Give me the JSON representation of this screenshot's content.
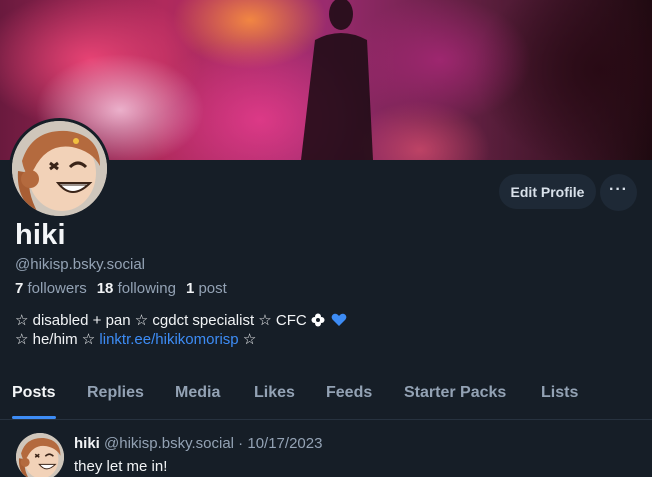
{
  "profile": {
    "display_name": "hiki",
    "handle": "@hikisp.bsky.social",
    "followers_count": "7",
    "followers_label": "followers",
    "following_count": "18",
    "following_label": "following",
    "posts_count": "1",
    "posts_label": "post",
    "bio_line1": "☆ disabled + pan ☆ cgdct specialist ☆ CFC",
    "bio_line2_prefix": "☆ he/him ☆ ",
    "bio_link": "linktr.ee/hikikomorisp",
    "bio_line2_suffix": " ☆"
  },
  "actions": {
    "edit_profile": "Edit Profile",
    "more": "···"
  },
  "tabs": [
    {
      "label": "Posts",
      "active": true
    },
    {
      "label": "Replies",
      "active": false
    },
    {
      "label": "Media",
      "active": false
    },
    {
      "label": "Likes",
      "active": false
    },
    {
      "label": "Feeds",
      "active": false
    },
    {
      "label": "Starter Packs",
      "active": false
    },
    {
      "label": "Lists",
      "active": false
    }
  ],
  "post": {
    "author_name": "hiki",
    "author_handle": "@hikisp.bsky.social",
    "separator": " · ",
    "date": "10/17/2023",
    "text": "they let me in!"
  },
  "icons": {
    "more": "ellipsis-icon",
    "flower": "flower-icon",
    "heart": "blue-heart-icon"
  },
  "colors": {
    "background": "#161e27",
    "accent": "#3d8cf5",
    "muted_text": "#93a2b4",
    "button_bg": "#1e2936"
  }
}
